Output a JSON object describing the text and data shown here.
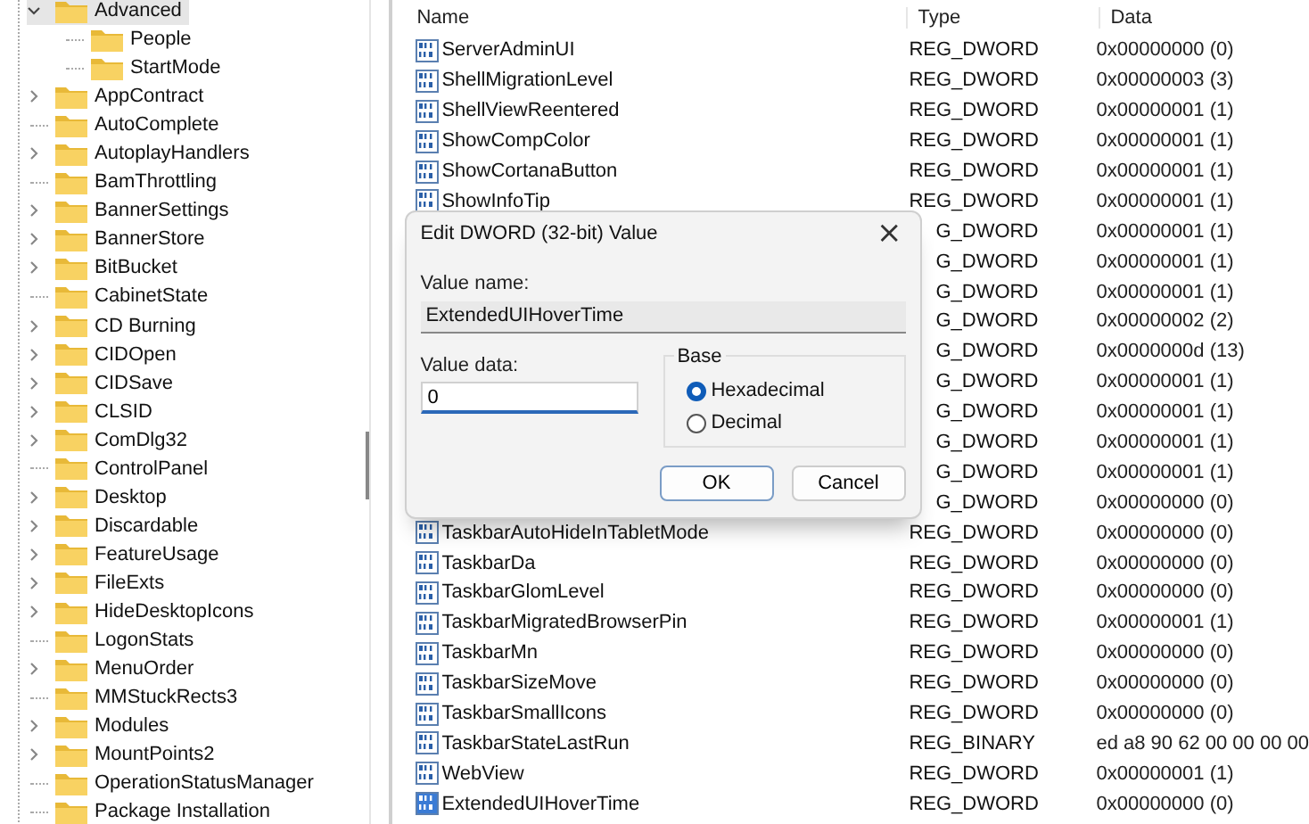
{
  "tree": [
    {
      "label": "Advanced",
      "expanded": true,
      "expandable": true,
      "selected": true,
      "children": [
        {
          "label": "People",
          "selected": false
        },
        {
          "label": "StartMode",
          "selected": false
        }
      ]
    },
    {
      "label": "AppContract",
      "expandable": true,
      "expanded": false,
      "selected": false
    },
    {
      "label": "AutoComplete",
      "expandable": false,
      "selected": false
    },
    {
      "label": "AutoplayHandlers",
      "expandable": true,
      "expanded": false,
      "selected": false
    },
    {
      "label": "BamThrottling",
      "expandable": false,
      "selected": false
    },
    {
      "label": "BannerSettings",
      "expandable": true,
      "expanded": false,
      "selected": false
    },
    {
      "label": "BannerStore",
      "expandable": true,
      "expanded": false,
      "selected": false
    },
    {
      "label": "BitBucket",
      "expandable": true,
      "expanded": false,
      "selected": false
    },
    {
      "label": "CabinetState",
      "expandable": false,
      "selected": false
    },
    {
      "label": "CD Burning",
      "expandable": true,
      "expanded": false,
      "selected": false
    },
    {
      "label": "CIDOpen",
      "expandable": true,
      "expanded": false,
      "selected": false
    },
    {
      "label": "CIDSave",
      "expandable": true,
      "expanded": false,
      "selected": false
    },
    {
      "label": "CLSID",
      "expandable": true,
      "expanded": false,
      "selected": false
    },
    {
      "label": "ComDlg32",
      "expandable": true,
      "expanded": false,
      "selected": false
    },
    {
      "label": "ControlPanel",
      "expandable": false,
      "selected": false
    },
    {
      "label": "Desktop",
      "expandable": true,
      "expanded": false,
      "selected": false
    },
    {
      "label": "Discardable",
      "expandable": true,
      "expanded": false,
      "selected": false
    },
    {
      "label": "FeatureUsage",
      "expandable": true,
      "expanded": false,
      "selected": false
    },
    {
      "label": "FileExts",
      "expandable": true,
      "expanded": false,
      "selected": false
    },
    {
      "label": "HideDesktopIcons",
      "expandable": true,
      "expanded": false,
      "selected": false
    },
    {
      "label": "LogonStats",
      "expandable": false,
      "selected": false
    },
    {
      "label": "MenuOrder",
      "expandable": true,
      "expanded": false,
      "selected": false
    },
    {
      "label": "MMStuckRects3",
      "expandable": false,
      "selected": false
    },
    {
      "label": "Modules",
      "expandable": true,
      "expanded": false,
      "selected": false
    },
    {
      "label": "MountPoints2",
      "expandable": true,
      "expanded": false,
      "selected": false
    },
    {
      "label": "OperationStatusManager",
      "expandable": false,
      "selected": false
    },
    {
      "label": "Package Installation",
      "expandable": false,
      "selected": false
    }
  ],
  "table": {
    "columns": [
      "Name",
      "Type",
      "Data"
    ],
    "rows": [
      {
        "name": "ServerAdminUI",
        "type": "REG_DWORD",
        "data": "0x00000000 (0)",
        "selected": false
      },
      {
        "name": "ShellMigrationLevel",
        "type": "REG_DWORD",
        "data": "0x00000003 (3)",
        "selected": false
      },
      {
        "name": "ShellViewReentered",
        "type": "REG_DWORD",
        "data": "0x00000001 (1)",
        "selected": false
      },
      {
        "name": "ShowCompColor",
        "type": "REG_DWORD",
        "data": "0x00000001 (1)",
        "selected": false
      },
      {
        "name": "ShowCortanaButton",
        "type": "REG_DWORD",
        "data": "0x00000001 (1)",
        "selected": false
      },
      {
        "name": "ShowInfoTip",
        "type": "REG_DWORD",
        "data": "0x00000001 (1)",
        "selected": false
      },
      {
        "type": "G_DWORD",
        "data": "0x00000001 (1)"
      },
      {
        "type": "G_DWORD",
        "data": "0x00000001 (1)"
      },
      {
        "type": "G_DWORD",
        "data": "0x00000001 (1)"
      },
      {
        "type": "G_DWORD",
        "data": "0x00000002 (2)"
      },
      {
        "type": "G_DWORD",
        "data": "0x0000000d (13)"
      },
      {
        "type": "G_DWORD",
        "data": "0x00000001 (1)"
      },
      {
        "type": "G_DWORD",
        "data": "0x00000001 (1)"
      },
      {
        "type": "G_DWORD",
        "data": "0x00000001 (1)"
      },
      {
        "type": "G_DWORD",
        "data": "0x00000001 (1)"
      },
      {
        "type": "G_DWORD",
        "data": "0x00000000 (0)"
      },
      {
        "name": "TaskbarAutoHideInTabletMode",
        "type": "REG_DWORD",
        "data": "0x00000000 (0)",
        "selected": false
      },
      {
        "name": "TaskbarDa",
        "type": "REG_DWORD",
        "data": "0x00000000 (0)",
        "selected": false
      },
      {
        "name": "TaskbarGlomLevel",
        "type": "REG_DWORD",
        "data": "0x00000000 (0)",
        "selected": false
      },
      {
        "name": "TaskbarMigratedBrowserPin",
        "type": "REG_DWORD",
        "data": "0x00000001 (1)",
        "selected": false
      },
      {
        "name": "TaskbarMn",
        "type": "REG_DWORD",
        "data": "0x00000000 (0)",
        "selected": false
      },
      {
        "name": "TaskbarSizeMove",
        "type": "REG_DWORD",
        "data": "0x00000000 (0)",
        "selected": false
      },
      {
        "name": "TaskbarSmallIcons",
        "type": "REG_DWORD",
        "data": "0x00000000 (0)",
        "selected": false
      },
      {
        "name": "TaskbarStateLastRun",
        "type": "REG_BINARY",
        "data": "ed a8 90 62 00 00 00 00",
        "selected": false
      },
      {
        "name": "WebView",
        "type": "REG_DWORD",
        "data": "0x00000001 (1)",
        "selected": false
      },
      {
        "name": "ExtendedUIHoverTime",
        "type": "REG_DWORD",
        "data": "0x00000000 (0)",
        "selected": true
      }
    ]
  },
  "dialog": {
    "title": "Edit DWORD (32-bit) Value",
    "close": "×",
    "value_name_label": "Value name:",
    "value_name": "ExtendedUIHoverTime",
    "value_data_label": "Value data:",
    "value_data": "0",
    "base_label": "Base",
    "base_options": [
      {
        "label": "Hexadecimal",
        "selected": true
      },
      {
        "label": "Decimal",
        "selected": false
      }
    ],
    "buttons": [
      "OK",
      "Cancel"
    ]
  }
}
